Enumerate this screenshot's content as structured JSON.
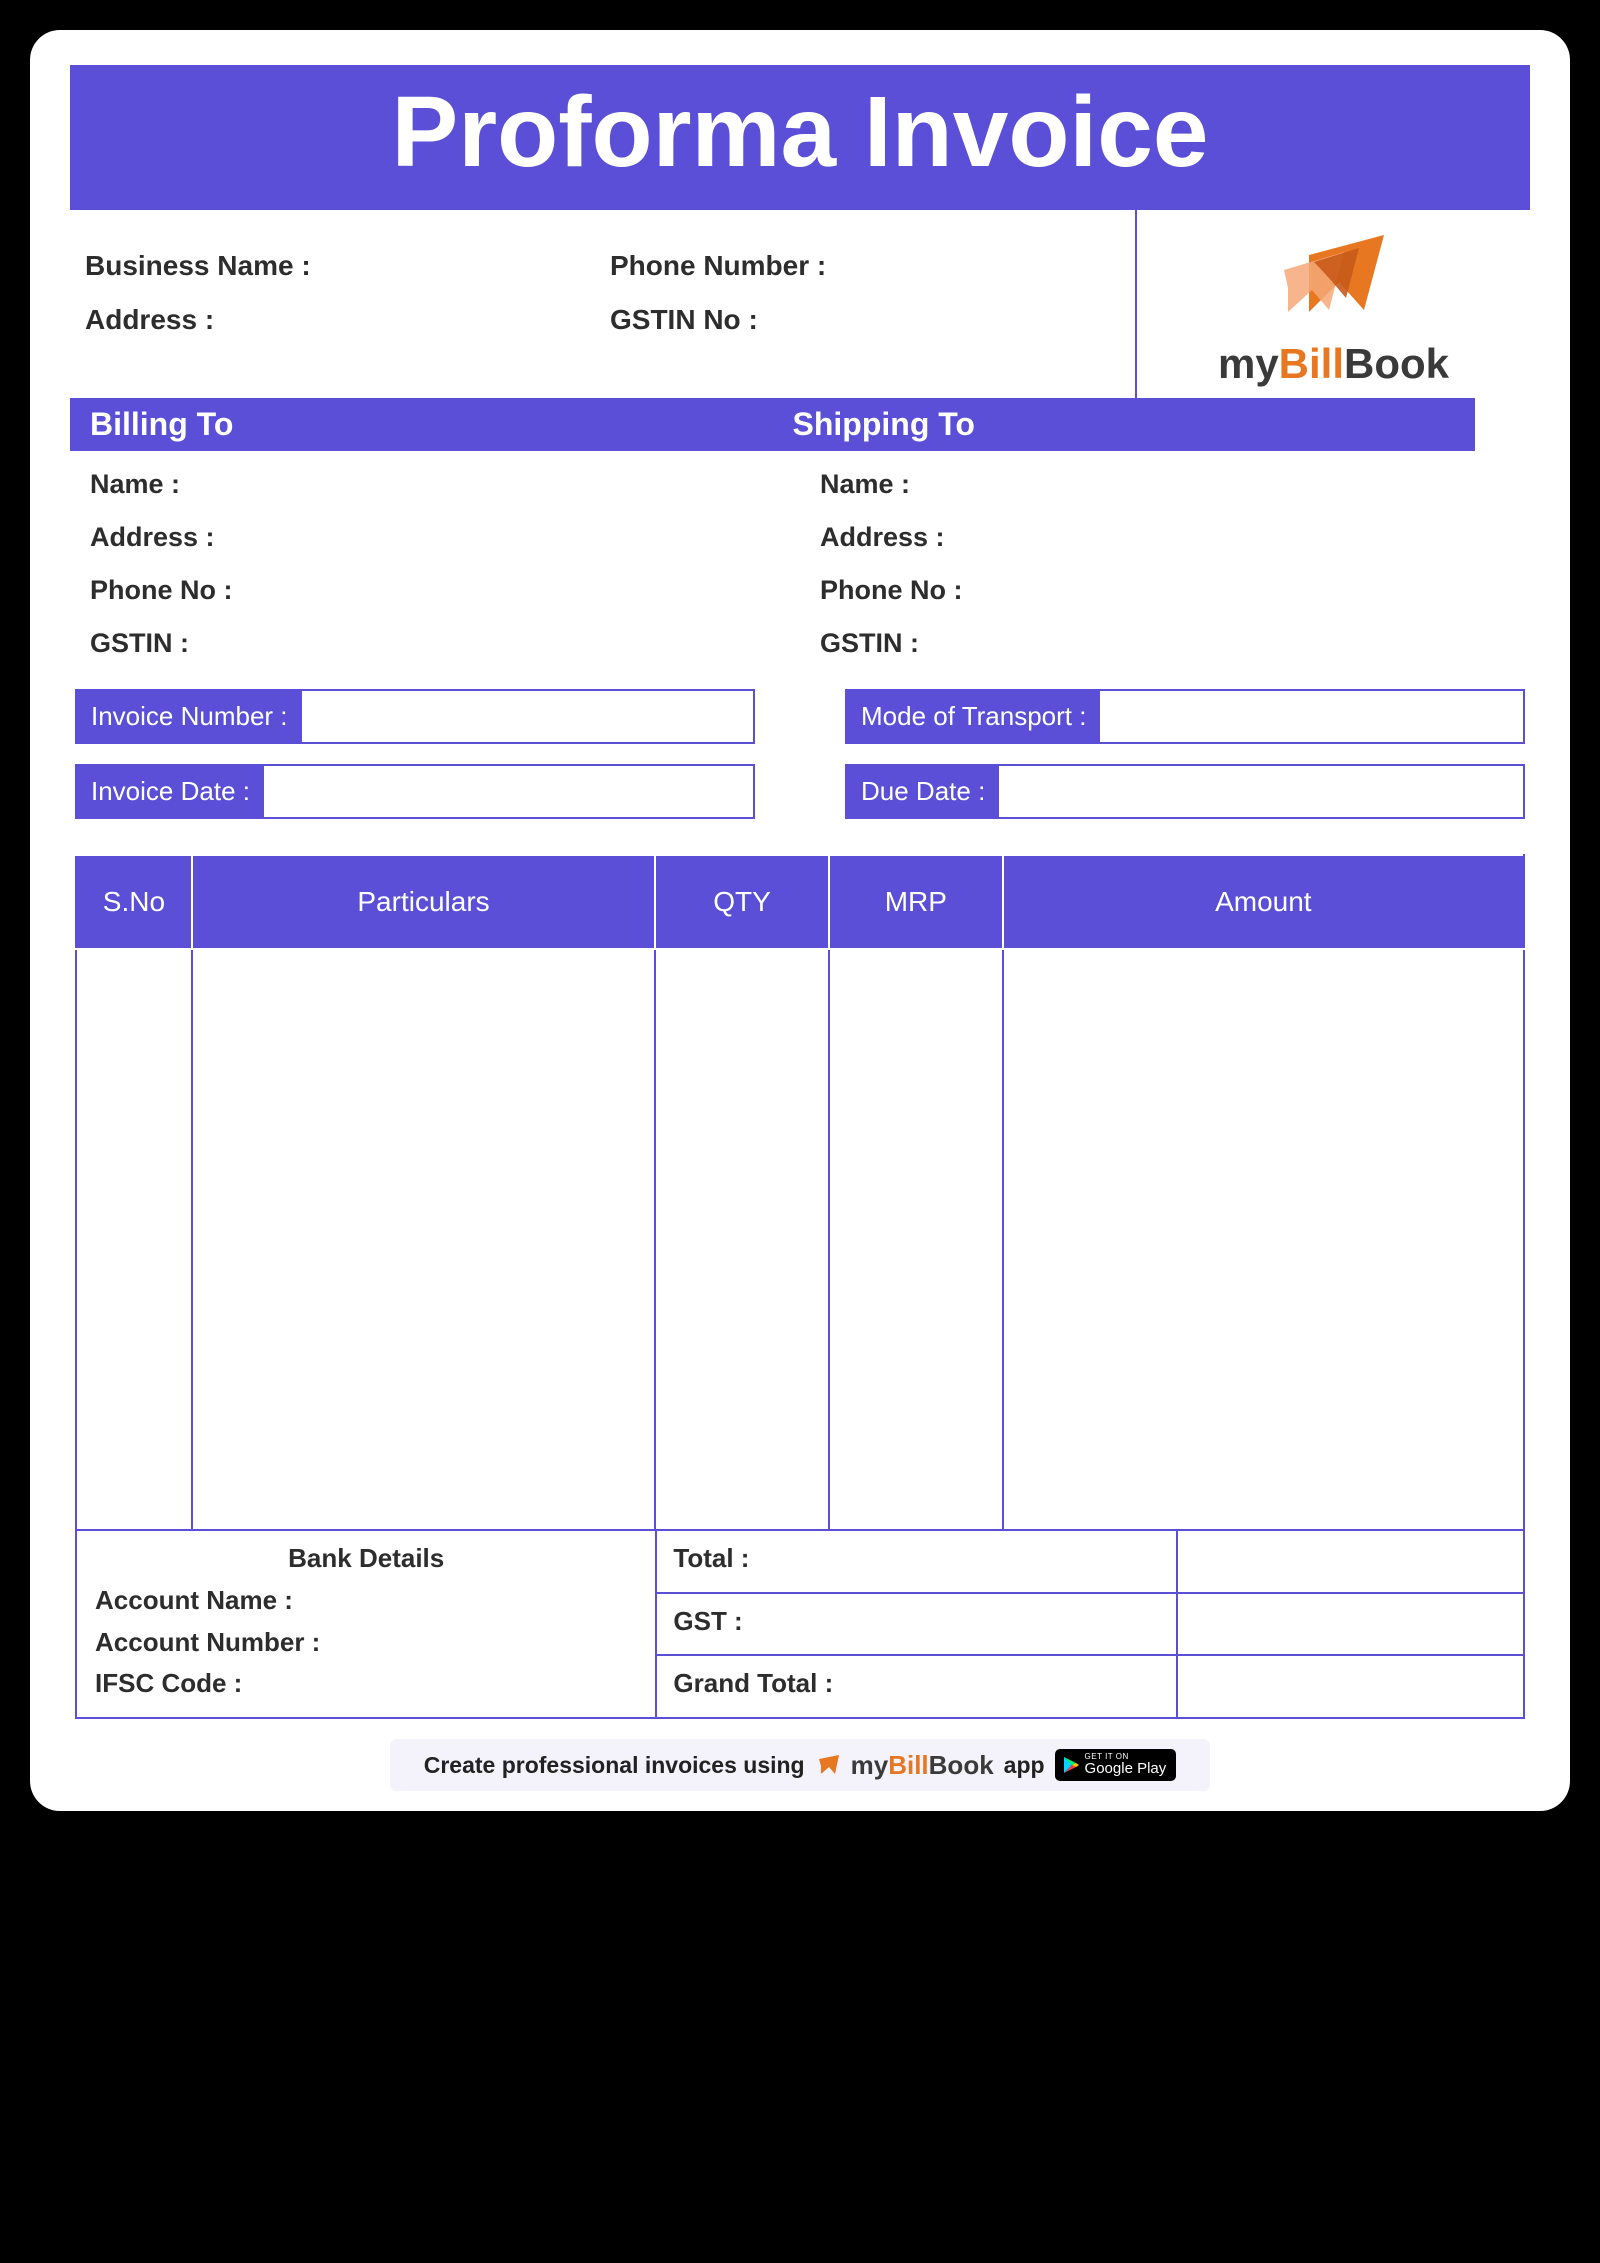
{
  "title": "Proforma Invoice",
  "header": {
    "business_name_label": "Business Name :",
    "address_label": "Address :",
    "phone_label": "Phone Number :",
    "gstin_label": "GSTIN No :"
  },
  "logo": {
    "my": "my",
    "bill": "Bill",
    "book": "Book"
  },
  "billing": {
    "heading": "Billing To",
    "name_label": "Name :",
    "address_label": "Address :",
    "phone_label": "Phone No :",
    "gstin_label": "GSTIN :"
  },
  "shipping": {
    "heading": "Shipping To",
    "name_label": "Name :",
    "address_label": "Address :",
    "phone_label": "Phone No :",
    "gstin_label": "GSTIN :"
  },
  "meta": {
    "invoice_number_label": "Invoice Number :",
    "mode_transport_label": "Mode of Transport :",
    "invoice_date_label": "Invoice Date :",
    "due_date_label": "Due Date :"
  },
  "table": {
    "headers": {
      "sno": "S.No",
      "particulars": "Particulars",
      "qty": "QTY",
      "mrp": "MRP",
      "amount": "Amount"
    }
  },
  "bank": {
    "heading": "Bank Details",
    "account_name_label": "Account Name :",
    "account_number_label": "Account Number :",
    "ifsc_label": "IFSC Code :"
  },
  "totals": {
    "total_label": "Total :",
    "gst_label": "GST :",
    "grand_total_label": "Grand Total :"
  },
  "promo": {
    "prefix": "Create professional invoices using",
    "app": "app",
    "gplay_small": "GET IT ON",
    "gplay_big": "Google Play"
  }
}
